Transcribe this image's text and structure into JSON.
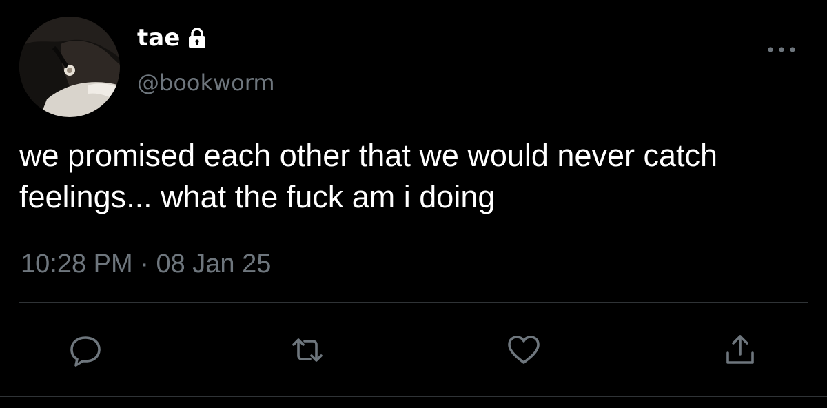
{
  "tweet": {
    "display_name": "tae",
    "handle": "@bookworm",
    "text": "we promised each other that we would never catch feelings... what the fuck am i doing",
    "time": "10:28 PM",
    "separator": "·",
    "date": "08 Jan 25"
  },
  "icons": {
    "lock": "lock-icon",
    "more": "more-icon",
    "reply": "reply-icon",
    "retweet": "retweet-icon",
    "like": "heart-icon",
    "share": "share-icon"
  },
  "colors": {
    "background": "#000000",
    "text": "#ffffff",
    "secondary": "#6e767d",
    "divider": "#2f3336"
  }
}
